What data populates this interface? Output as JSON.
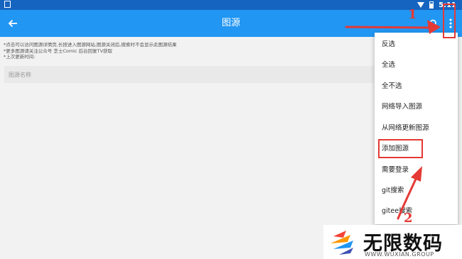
{
  "status_bar": {
    "time": "5:11"
  },
  "app_bar": {
    "title": "图源",
    "back_icon": "arrow-left-icon",
    "search_icon": "search-icon",
    "more_icon": "more-vert-icon"
  },
  "notes": {
    "line1": "*点击可以访问图源详情页,长按进入图源网站,图源关闭后,搜索时不会显示此图源结果",
    "line2": "*更多图源请关注公众号 芝士Comic 后台回复TV获取",
    "line3": "*上次更新时间:"
  },
  "search": {
    "placeholder": "图源名称"
  },
  "menu": {
    "items": [
      {
        "label": "反选"
      },
      {
        "label": "全选"
      },
      {
        "label": "全不选"
      },
      {
        "label": "网络导入图源"
      },
      {
        "label": "从网络更新图源"
      },
      {
        "label": "添加图源"
      },
      {
        "label": "需要登录"
      },
      {
        "label": "git搜索"
      },
      {
        "label": "gitee搜索"
      }
    ]
  },
  "annotations": {
    "step1": "1",
    "step2": "2"
  },
  "watermark": {
    "text": "无限数码",
    "url": "WWW.WUXIAN.GROUP"
  },
  "colors": {
    "status_bar": "#1565c0",
    "app_bar": "#2196f3",
    "annotation": "#e53935",
    "background": "#f2f2f2"
  }
}
